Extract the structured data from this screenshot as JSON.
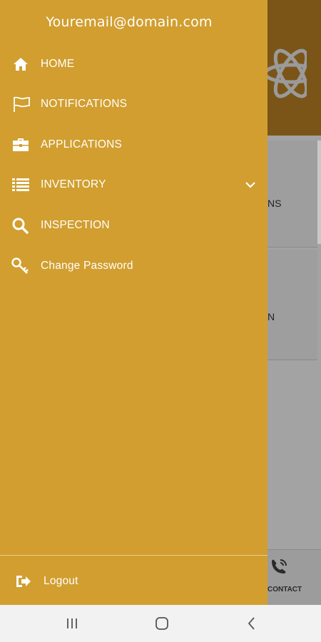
{
  "drawer": {
    "email": "Youremail@domain.com",
    "items": [
      {
        "label": "HOME",
        "icon": "home-icon"
      },
      {
        "label": "NOTIFICATIONS",
        "icon": "flag-icon"
      },
      {
        "label": "APPLICATIONS",
        "icon": "briefcase-icon"
      },
      {
        "label": "INVENTORY",
        "icon": "list-icon"
      },
      {
        "label": "INSPECTION",
        "icon": "search-icon"
      },
      {
        "label": "Change Password",
        "icon": "key-icon"
      }
    ],
    "logout_label": "Logout",
    "background_color": "#d19e2f"
  },
  "background": {
    "card1_text": "NS",
    "card2_text": "N",
    "contact_label": "CONTACT",
    "header_color": "#7b5518"
  },
  "navbar": {
    "buttons": [
      "recents-icon",
      "home-button-icon",
      "back-icon"
    ]
  }
}
